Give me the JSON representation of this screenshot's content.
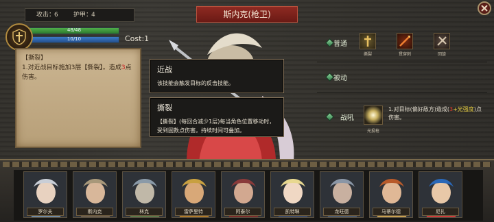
{
  "stats": {
    "attack_label": "攻击：",
    "attack_value": "6",
    "armor_label": "护甲：",
    "armor_value": "4"
  },
  "hp": {
    "text": "48/48",
    "fraction": 1.0
  },
  "mp": {
    "text": "10/10",
    "fraction": 1.0
  },
  "cost": "Cost:1",
  "character_name": "斯内克(枪卫)",
  "description": {
    "title": "【撕裂】",
    "line_pre": "1.对近战目标施加3层【撕裂】。造成",
    "highlight": "3",
    "line_post": "点伤害。"
  },
  "melee_box": {
    "title": "近战",
    "desc": "该技能会触发目标的反击技能。"
  },
  "tear_box": {
    "title": "撕裂",
    "desc": "【撕裂】(每回合减少1层)每当角色位置移动时，受到固数点伤害。持续时间可叠加。"
  },
  "right_panel": {
    "normal_label": "普通",
    "passive_label": "被动",
    "battlecry_label": "战吼",
    "skills": [
      {
        "caption": "撕裂",
        "icon": "sword-cross-icon",
        "color": "#c8a24a"
      },
      {
        "caption": "贯穿刺",
        "icon": "spear-icon",
        "color": "#c84a1a"
      },
      {
        "caption": "回旋",
        "icon": "spin-icon",
        "color": "#9a8470"
      }
    ],
    "battlecry_icon": "light-spear-icon",
    "battlecry_caption": "光投枪",
    "battlecry_text_pre": "1.对目标(偏好敌方)造成(",
    "battlecry_highlight_red": "3",
    "battlecry_highlight_yel": "+光强度",
    "battlecry_text_post": ")点伤害。"
  },
  "roster": [
    {
      "name": "罗尔夫",
      "hair": "#c9ced6",
      "skin": "#e8d2c0",
      "accent": "#6f8aa6"
    },
    {
      "name": "斯内克",
      "hair": "#a8987a",
      "skin": "#d8b79a",
      "accent": "#6d6050"
    },
    {
      "name": "林克",
      "hair": "#8a9aa8",
      "skin": "#c0b8a8",
      "accent": "#5a7a4a"
    },
    {
      "name": "雷萨里特",
      "hair": "#c8a040",
      "skin": "#d8a878",
      "accent": "#b07a28"
    },
    {
      "name": "阿泰尔",
      "hair": "#8a3a3a",
      "skin": "#d2a890",
      "accent": "#7a2a2a"
    },
    {
      "name": "凯特琳",
      "hair": "#e8d890",
      "skin": "#f0d8c4",
      "accent": "#3a4a6a"
    },
    {
      "name": "龙旺德",
      "hair": "#8a96a6",
      "skin": "#c8b0a0",
      "accent": "#4a5a70"
    },
    {
      "name": "马蒂尔德",
      "hair": "#b85a2a",
      "skin": "#e0b896",
      "accent": "#c8a050"
    },
    {
      "name": "尼扎",
      "hair": "#2a68b8",
      "skin": "#e8c8a8",
      "accent": "#d03a3a"
    }
  ],
  "colors": {
    "banner": "#8e2a22",
    "hp": "#4fae4a",
    "mp": "#3c7bc8",
    "highlight_red": "#c82020"
  }
}
